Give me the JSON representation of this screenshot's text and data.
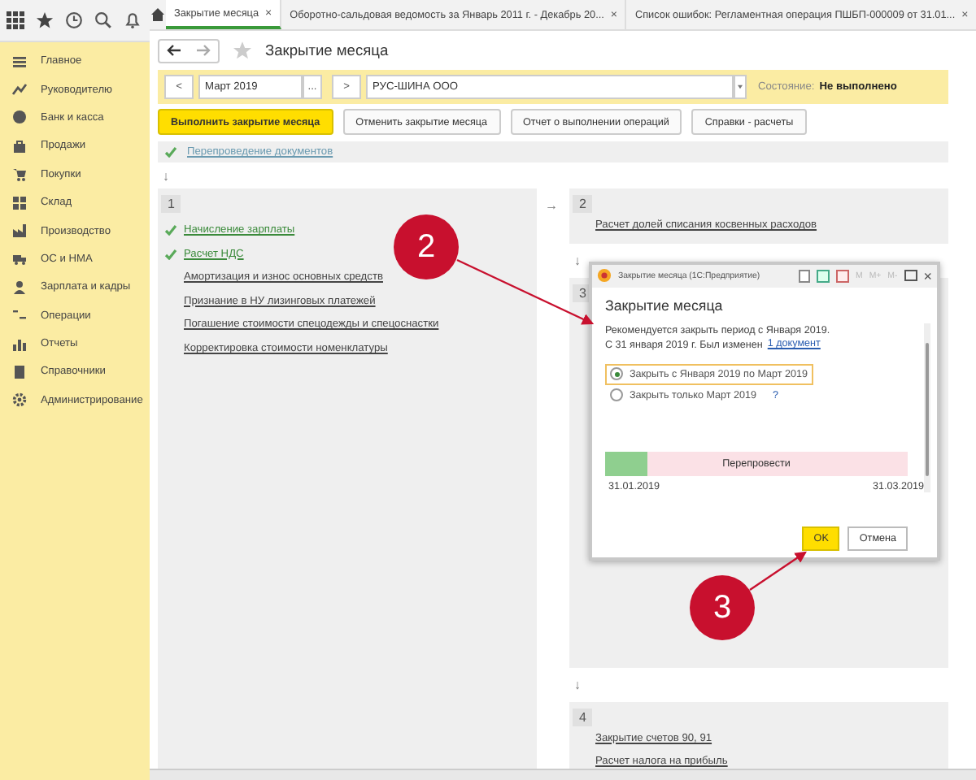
{
  "sidebar": {
    "items": [
      {
        "label": "Главное"
      },
      {
        "label": "Руководителю"
      },
      {
        "label": "Банк и касса"
      },
      {
        "label": "Продажи"
      },
      {
        "label": "Покупки"
      },
      {
        "label": "Склад"
      },
      {
        "label": "Производство"
      },
      {
        "label": "ОС и НМА"
      },
      {
        "label": "Зарплата и кадры"
      },
      {
        "label": "Операции"
      },
      {
        "label": "Отчеты"
      },
      {
        "label": "Справочники"
      },
      {
        "label": "Администрирование"
      }
    ]
  },
  "tabs": [
    {
      "label": "Закрытие месяца",
      "selected": true,
      "close": "×"
    },
    {
      "label": "Оборотно-сальдовая ведомость за Январь 2011 г. - Декабрь 20...",
      "selected": false,
      "close": "×"
    },
    {
      "label": "Список ошибок: Регламентная операция ПШБП-000009 от 31.01...",
      "selected": false,
      "close": "×"
    }
  ],
  "page": {
    "title": "Закрытие месяца"
  },
  "filter": {
    "prev": "<",
    "period": "Март 2019",
    "picker": "...",
    "next": ">",
    "organization": "РУС-ШИНА ООО",
    "status_label": "Состояние:",
    "status_value": "Не выполнено"
  },
  "buttons": [
    {
      "label": "Выполнить закрытие месяца",
      "kind": "primary"
    },
    {
      "label": "Отменить закрытие месяца",
      "kind": "default"
    },
    {
      "label": "Отчет о выполнении операций",
      "kind": "default"
    },
    {
      "label": "Справки - расчеты",
      "kind": "default"
    }
  ],
  "reposting": {
    "label": "Перепроведение документов",
    "done": true
  },
  "steps": [
    {
      "arrow": "↓",
      "number": "1",
      "items": [
        {
          "label": "Начисление зарплаты",
          "done": true
        },
        {
          "label": "Расчет НДС",
          "done": true
        },
        {
          "label": "Амортизация и износ основных средств",
          "done": false
        },
        {
          "label": "Признание в НУ лизинговых платежей",
          "done": false
        },
        {
          "label": "Погашение стоимости спецодежды и спецоснастки",
          "done": false
        },
        {
          "label": "Корректировка стоимости номенклатуры",
          "done": false
        }
      ]
    },
    {
      "arrow": "→",
      "number": "2",
      "items": [
        {
          "label": "Расчет долей списания косвенных расходов",
          "done": false
        }
      ]
    },
    {
      "arrow": "↓",
      "number": "3"
    },
    {
      "arrow": "↓",
      "number": "4",
      "items": [
        {
          "label": "Закрытие счетов 90, 91",
          "done": false
        },
        {
          "label": "Расчет налога на прибыль",
          "done": false
        }
      ]
    }
  ],
  "dialog": {
    "window_title": "Закрытие месяца (1С:Предприятие)",
    "memory_buttons": [
      "M",
      "M+",
      "M-"
    ],
    "close": "×",
    "title": "Закрытие месяца",
    "message": "Рекомендуется закрыть период с Января 2019.",
    "detail": "С 31 января 2019 г. Был изменен",
    "link": "1 документ",
    "options": [
      {
        "label": "Закрыть с Января 2019 по Март 2019",
        "selected": true
      },
      {
        "label": "Закрыть только Март 2019",
        "selected": false
      }
    ],
    "help": "?",
    "timeline": {
      "level": 0.14,
      "label": "Перепровести",
      "start": "31.01.2019",
      "end": "31.03.2019"
    },
    "buttons": [
      {
        "label": "OK",
        "kind": "primary"
      },
      {
        "label": "Отмена",
        "kind": "default"
      }
    ]
  },
  "annotations": [
    {
      "number": "2"
    },
    {
      "number": "3"
    }
  ]
}
